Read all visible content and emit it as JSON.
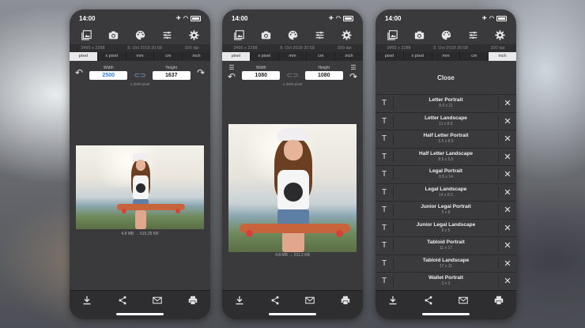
{
  "status": {
    "time": "14:00"
  },
  "info": {
    "dimensions": "3495 x 2288",
    "date": "8. Oct 2018 20:58",
    "dpi": "300 dpi"
  },
  "units": [
    "pixel",
    "x pixel",
    "mm",
    "cm",
    "inch"
  ],
  "phone1": {
    "width_label": "Width",
    "width_value": "2500",
    "height_label": "Height",
    "height_value": "1637",
    "max_note": "≤ 3000 pixel",
    "file_size": "4.8 MB → 615.25 KB",
    "active_unit": 0
  },
  "phone2": {
    "width_label": "Width",
    "width_value": "1080",
    "height_label": "Height",
    "height_value": "1080",
    "max_note": "≤ 3000 pixel",
    "file_size": "4.8 MB → 211.2 KB",
    "active_unit": 0
  },
  "phone3": {
    "active_unit": 4,
    "close_label": "Close",
    "presets": [
      {
        "name": "Letter Portrait",
        "dim": "8.5 x 11"
      },
      {
        "name": "Letter Landscape",
        "dim": "11 x 8.5"
      },
      {
        "name": "Half Letter Portrait",
        "dim": "5.5 x 8.5"
      },
      {
        "name": "Half Letter Landscape",
        "dim": "8.5 x 5.5"
      },
      {
        "name": "Legal Portrait",
        "dim": "8.5 x 14"
      },
      {
        "name": "Legal Landscape",
        "dim": "14 x 8.5"
      },
      {
        "name": "Junior Legal Portrait",
        "dim": "5 x 8"
      },
      {
        "name": "Junior Legal Landscape",
        "dim": "8 x 5"
      },
      {
        "name": "Tabloid Portrait",
        "dim": "11 x 17"
      },
      {
        "name": "Tabloid Landscape",
        "dim": "17 x 11"
      },
      {
        "name": "Wallet Portrait",
        "dim": "2 x 3"
      }
    ]
  },
  "icons": {
    "toolbar": [
      "photo-library-icon",
      "camera-icon",
      "palette-icon",
      "sliders-icon",
      "gear-icon"
    ],
    "bottom": [
      "download-icon",
      "share-icon",
      "mail-icon",
      "print-icon"
    ]
  }
}
